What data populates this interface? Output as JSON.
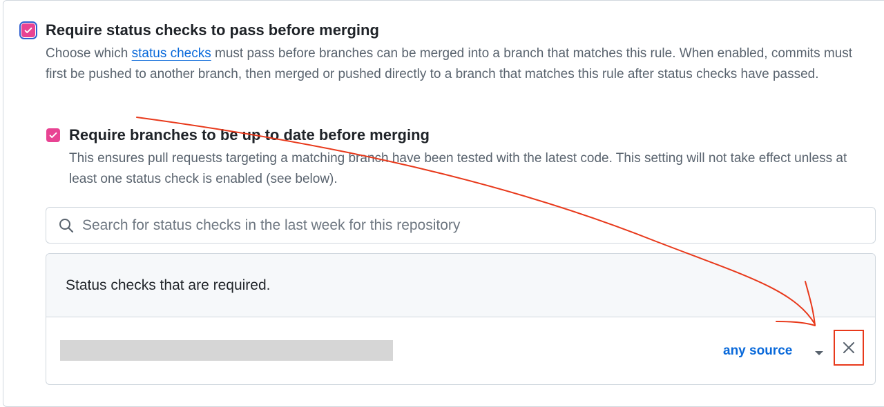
{
  "rule": {
    "checked": true,
    "title": "Require status checks to pass before merging",
    "description_before_link": "Choose which ",
    "link_text": "status checks",
    "description_after_link": " must pass before branches can be merged into a branch that matches this rule. When enabled, commits must first be pushed to another branch, then merged or pushed directly to a branch that matches this rule after status checks have passed."
  },
  "subrule": {
    "checked": true,
    "title": "Require branches to be up to date before merging",
    "description": "This ensures pull requests targeting a matching branch have been tested with the latest code. This setting will not take effect unless at least one status check is enabled (see below)."
  },
  "search": {
    "icon": "search-icon",
    "placeholder": "Search for status checks in the last week for this repository",
    "value": ""
  },
  "required_checks": {
    "header": "Status checks that are required.",
    "items": [
      {
        "name_redacted": true,
        "source_label": "any source",
        "remove_icon": "close-icon"
      }
    ]
  },
  "colors": {
    "checkbox": "#e84393",
    "link": "#0969da",
    "annotation": "#e8391b"
  }
}
